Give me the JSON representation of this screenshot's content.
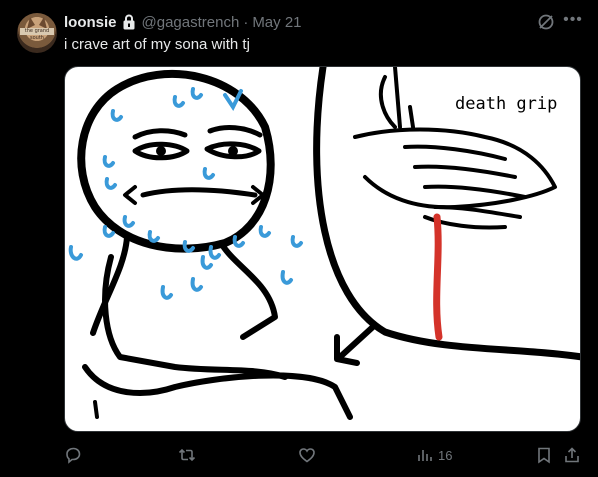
{
  "tweet": {
    "display_name": "loonsie",
    "handle": "@gagastrench",
    "separator": "·",
    "date": "May 21",
    "text": "i crave art of my sona with tj",
    "avatar_tag": "the grand south"
  },
  "media": {
    "caption": "death grip"
  },
  "actions": {
    "views_count": "16"
  },
  "icons": {
    "lock": "lock-icon",
    "grok": "grok-icon",
    "more": "more-icon",
    "reply": "reply-icon",
    "retweet": "retweet-icon",
    "like": "like-icon",
    "views": "views-icon",
    "bookmark": "bookmark-icon",
    "share": "share-icon"
  },
  "colors": {
    "background": "#000000",
    "primary_text": "#e7e9ea",
    "secondary_text": "#71767b",
    "sweat_blue": "#3a9ad9",
    "blood_red": "#d4332a"
  }
}
